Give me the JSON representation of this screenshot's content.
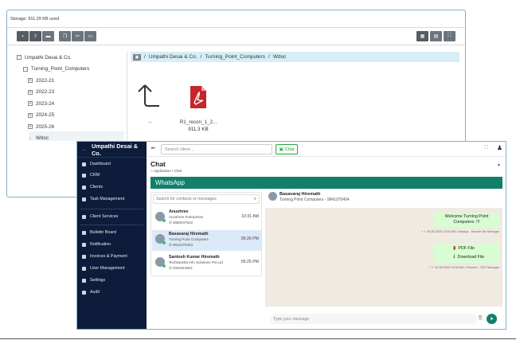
{
  "file_manager": {
    "storage": "Storage: 911.29 KB used",
    "tree": [
      {
        "label": "Umpathi Desai & Co.",
        "toggle": "-"
      },
      {
        "label": "Turning_Point_Computers",
        "toggle": "-"
      },
      {
        "label": "2022-21",
        "toggle": "+"
      },
      {
        "label": "2022-23",
        "toggle": "+"
      },
      {
        "label": "2023-24",
        "toggle": "+"
      },
      {
        "label": "2024-25",
        "toggle": "+"
      },
      {
        "label": "2025-26",
        "toggle": "+"
      },
      {
        "label": "Wdoc",
        "toggle": "-"
      }
    ],
    "breadcrumb": [
      "Umpathi Desai & Co.",
      "Turning_Point_Computers",
      "Wdoc"
    ],
    "up_label": "..",
    "file": {
      "name_line1": "R1_recon_1_2...",
      "size": "911.3 KB"
    }
  },
  "chat_app": {
    "brand": "Umpathi Desai & Co.",
    "sidebar": [
      {
        "label": "Dashboard"
      },
      {
        "label": "CRM"
      },
      {
        "label": "Clients"
      },
      {
        "label": "Task Management"
      },
      {
        "label": "Client Services"
      },
      {
        "label": "Bulletin Board"
      },
      {
        "label": "Notification"
      },
      {
        "label": "Invoices & Payment"
      },
      {
        "label": "User Management"
      },
      {
        "label": "Settings"
      },
      {
        "label": "Audit"
      }
    ],
    "search_client_placeholder": "Search client...",
    "chat_button": "Chat",
    "page_title": "Chat",
    "page_crumb": "Application  /  Chat",
    "whatsapp": "WhatsApp",
    "contact_search_placeholder": "Search for contacts or messages",
    "contacts": [
      {
        "name": "Anushree",
        "org": "Anushree Enterprises",
        "phone": "9860047642",
        "time": "10:31 AM"
      },
      {
        "name": "Basavaraj Hiremath",
        "org": "Turning Point Computers",
        "phone": "9841070404",
        "time": "05:26 PM"
      },
      {
        "name": "Santosh Kumar Hiremath",
        "org": "Techkaveba Info Solutions Pvt.Ltd",
        "phone": "9342913921",
        "time": "05:25 PM"
      }
    ],
    "conversation": {
      "name": "Basavaraj Hiremath",
      "subtitle": "Turning Point Computers - 9841070404",
      "messages": [
        {
          "text": "Welcome Turning Point Computers .!!!",
          "meta": "20-06-2025 11:54 AM  • Anaaya - Income Tax Manager"
        },
        {
          "title": "PDF File",
          "link": "Download File",
          "meta": "20-06-2025 11:54 AM  • Praveen - GST Manager"
        }
      ]
    },
    "message_placeholder": "Type your message"
  },
  "colors": {
    "whatsapp_green": "#11806b",
    "sidebar_bg": "#0c1c3a",
    "bubble": "#d9fdd3"
  }
}
